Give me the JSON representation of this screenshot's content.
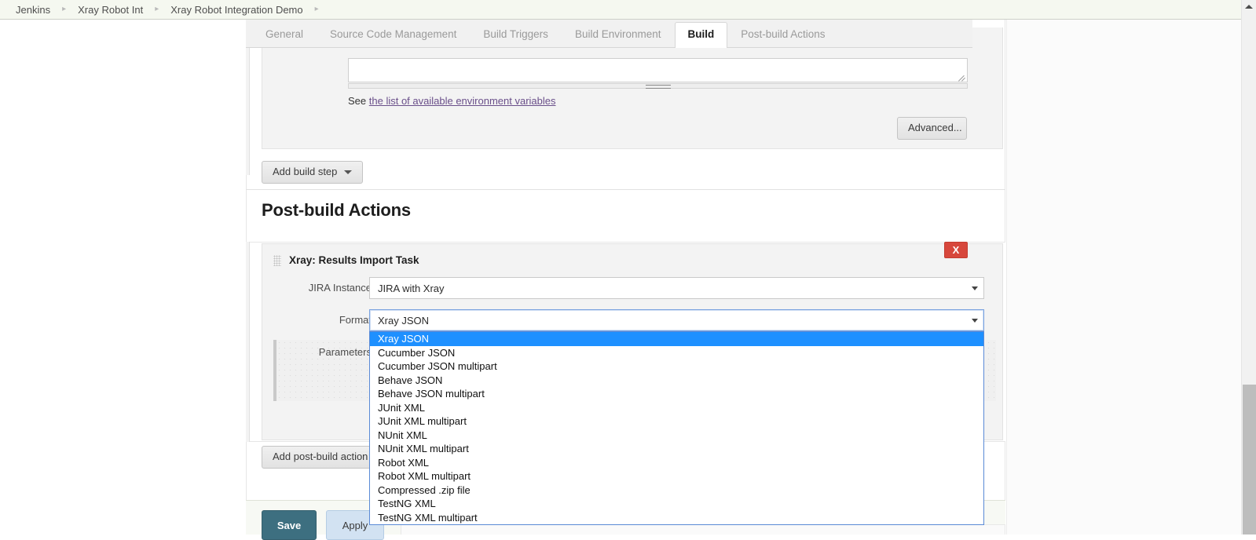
{
  "breadcrumb": {
    "items": [
      {
        "label": "Jenkins"
      },
      {
        "label": "Xray Robot Int"
      },
      {
        "label": "Xray Robot Integration Demo"
      }
    ],
    "separator": "▸"
  },
  "tabs": [
    {
      "label": "General",
      "active": false
    },
    {
      "label": "Source Code Management",
      "active": false
    },
    {
      "label": "Build Triggers",
      "active": false
    },
    {
      "label": "Build Environment",
      "active": false
    },
    {
      "label": "Build",
      "active": true
    },
    {
      "label": "Post-build Actions",
      "active": false
    }
  ],
  "build_step": {
    "command_value": "",
    "env_prefix": "See",
    "env_link_text": "the list of available environment variables",
    "advanced_label": "Advanced...",
    "add_build_step_label": "Add build step"
  },
  "post_build": {
    "heading": "Post-build Actions",
    "task_title": "Xray: Results Import Task",
    "delete_label": "X",
    "add_action_label": "Add post-build action",
    "fields": {
      "jira_instance_label": "JIRA Instance",
      "jira_instance_value": "JIRA with Xray",
      "format_label": "Format",
      "format_value": "Xray JSON",
      "parameters_label": "Parameters"
    }
  },
  "format_dropdown": {
    "selected": "Xray JSON",
    "options": [
      "Xray JSON",
      "Cucumber JSON",
      "Cucumber JSON multipart",
      "Behave JSON",
      "Behave JSON multipart",
      "JUnit XML",
      "JUnit XML multipart",
      "NUnit XML",
      "NUnit XML multipart",
      "Robot XML",
      "Robot XML multipart",
      "Compressed .zip file",
      "TestNG XML",
      "TestNG XML multipart"
    ]
  },
  "footer": {
    "save_label": "Save",
    "apply_label": "Apply"
  },
  "colors": {
    "accent_save": "#3d6f80",
    "accent_apply": "#d2e2f2",
    "delete_red": "#d7473c",
    "dropdown_highlight": "#1e90ff",
    "breadcrumb_bg": "#f5f8f0"
  }
}
